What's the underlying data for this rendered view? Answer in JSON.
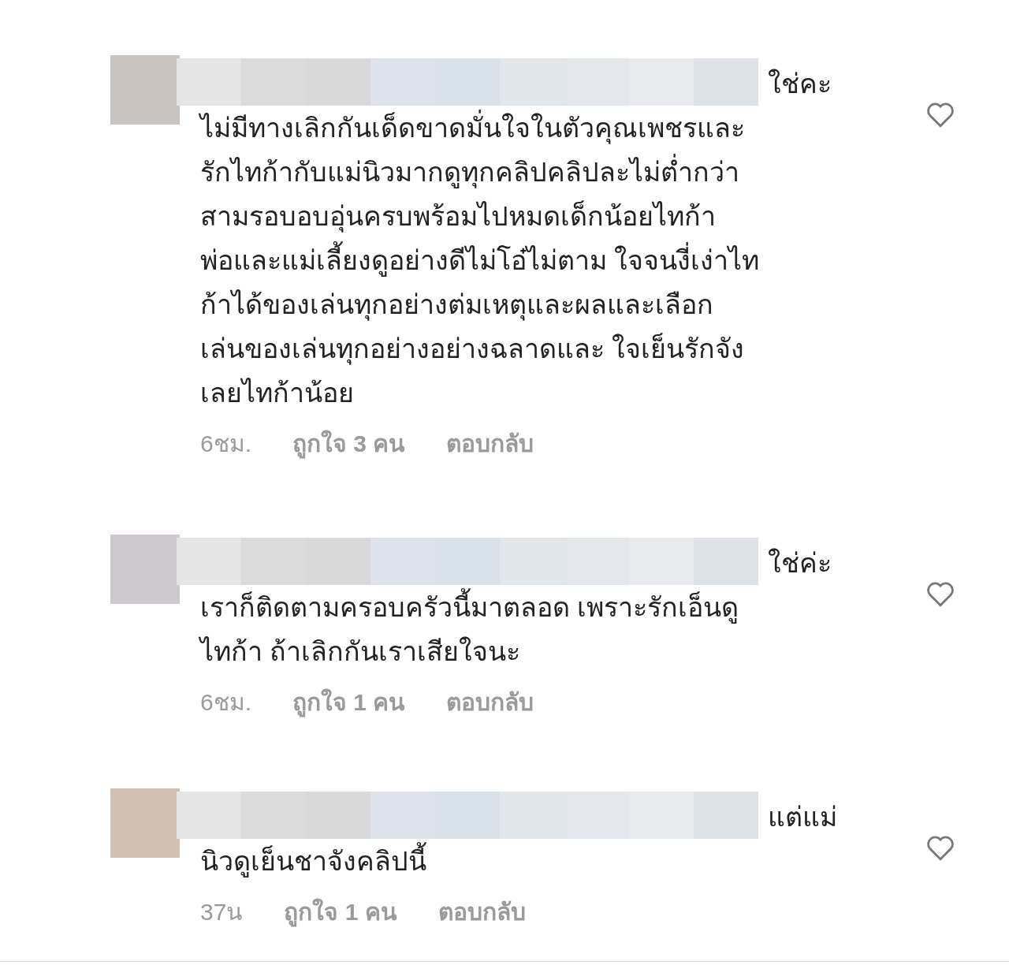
{
  "comments": [
    {
      "color": "#c9c4bf",
      "lead": "ใช่คะ",
      "lines": [
        "ไม่มีทางเลิกกันเด็ดขาดมั่นใจในตัวคุณเพชรและ",
        "รักไทก้ากับแม่นิวมากดูทุกคลิปคลิปละไม่ต่ำกว่า",
        "สามรอบอบอุ่นครบพร้อมไปหมดเด็กน้อยไทก้า",
        "พ่อและแม่เลี้ยงดูอย่างดีไม่โอ๋ไม่ตาม ใจจนงี่เง่าไท",
        "ก้าได้ของเล่นทุกอย่างต่มเหตุและผลและเลือก",
        "เล่นของเล่นทุกอย่างอย่างฉลาดและ ใจเย็นรักจัง",
        "เลยไทก้าน้อย"
      ],
      "time": "6ชม.",
      "likes": "ถูกใจ 3 คน",
      "reply": "ตอบกลับ"
    },
    {
      "color": "#cdcacd",
      "lead": "ใช่ค่ะ",
      "lines": [
        "เราก็ติดตามครอบครัวนี้มาตลอด เพราะรักเอ็นดู",
        "ไทก้า ถ้าเลิกกันเราเสียใจนะ"
      ],
      "time": "6ชม.",
      "likes": "ถูกใจ 1 คน",
      "reply": "ตอบกลับ"
    },
    {
      "color": "#d2c0b2",
      "lead": "แต่แม่",
      "lines": [
        "นิวดูเย็นชาจังคลิปนี้"
      ],
      "time": "37น",
      "likes": "ถูกใจ 1 คน",
      "reply": "ตอบกลับ"
    }
  ]
}
